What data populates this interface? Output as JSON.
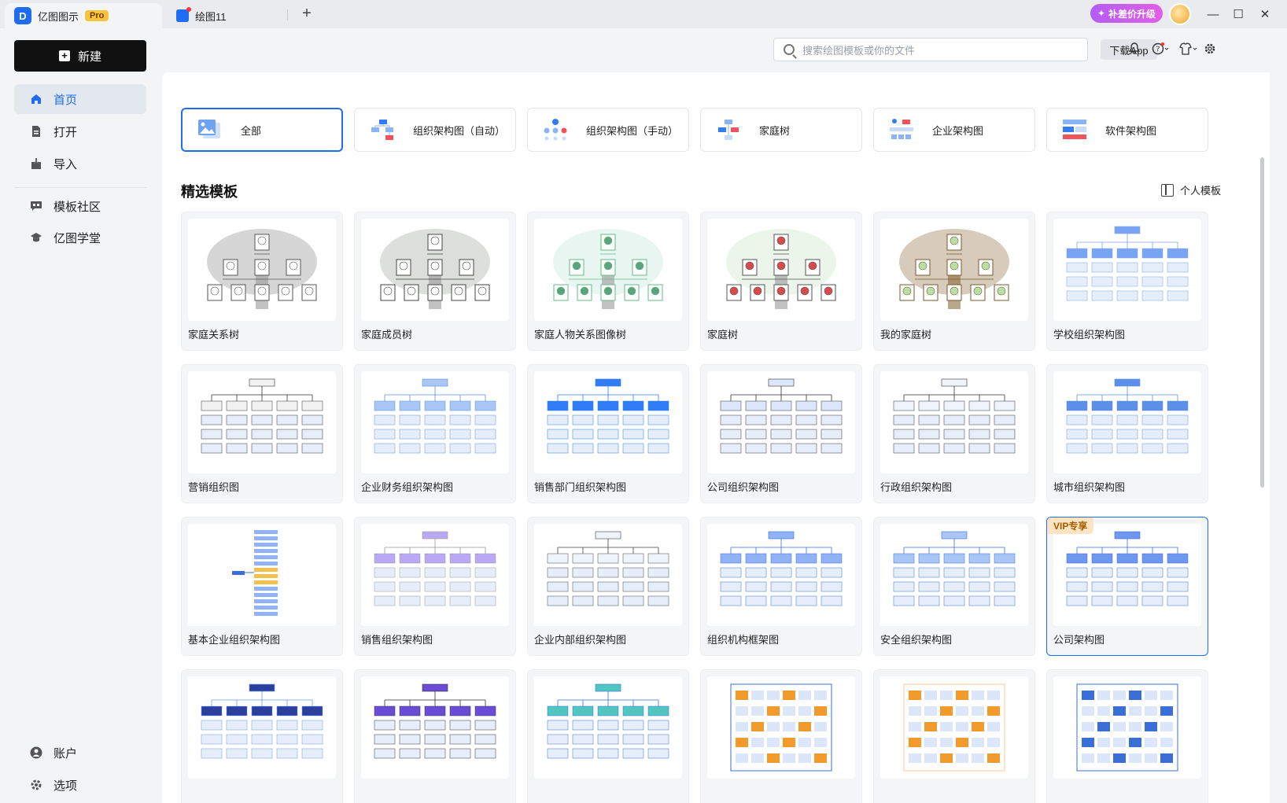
{
  "app": {
    "name": "亿图图示",
    "badge": "Pro",
    "doc_tab": "绘图11"
  },
  "titlebar": {
    "upgrade": "补差价升级"
  },
  "sidebar": {
    "new_label": "新建",
    "nav": [
      {
        "label": "首页"
      },
      {
        "label": "打开"
      },
      {
        "label": "导入"
      },
      {
        "label": "模板社区"
      },
      {
        "label": "亿图学堂"
      }
    ],
    "bottom": [
      {
        "label": "账户"
      },
      {
        "label": "选项"
      }
    ]
  },
  "topbar": {
    "search_placeholder": "搜索绘图模板或你的文件",
    "download": "下载App"
  },
  "categories": [
    {
      "label": "全部"
    },
    {
      "label": "组织架构图（自动）"
    },
    {
      "label": "组织架构图（手动）"
    },
    {
      "label": "家庭树"
    },
    {
      "label": "企业架构图"
    },
    {
      "label": "软件架构图"
    }
  ],
  "section": {
    "title": "精选模板",
    "personal": "个人模板"
  },
  "templates": [
    {
      "label": "家庭关系树"
    },
    {
      "label": "家庭成员树"
    },
    {
      "label": "家庭人物关系图像树"
    },
    {
      "label": "家庭树"
    },
    {
      "label": "我的家庭树"
    },
    {
      "label": "学校组织架构图"
    },
    {
      "label": "营销组织图"
    },
    {
      "label": "企业财务组织架构图"
    },
    {
      "label": "销售部门组织架构图"
    },
    {
      "label": "公司组织架构图"
    },
    {
      "label": "行政组织架构图"
    },
    {
      "label": "城市组织架构图"
    },
    {
      "label": "基本企业组织架构图"
    },
    {
      "label": "销售组织架构图"
    },
    {
      "label": "企业内部组织架构图"
    },
    {
      "label": "组织机构框架图"
    },
    {
      "label": "安全组织架构图"
    },
    {
      "label": "公司架构图",
      "vip": "VIP专享"
    },
    {
      "label": ""
    },
    {
      "label": ""
    },
    {
      "label": ""
    },
    {
      "label": ""
    },
    {
      "label": ""
    },
    {
      "label": ""
    }
  ]
}
